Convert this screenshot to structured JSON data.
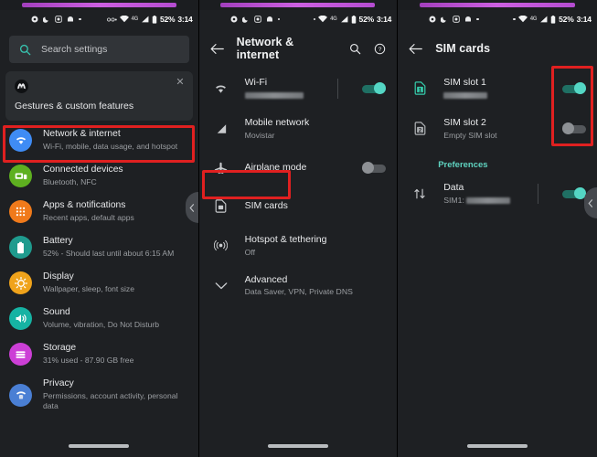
{
  "statusbar": {
    "notif_icons": [
      "record-icon",
      "dnd-moon-icon",
      "screenshot-icon",
      "arch-icon",
      "dot-icon"
    ],
    "vpn_icon": "vpn-key-icon",
    "wifi_icon": "wifi-icon",
    "network_type": "4G",
    "signal_icon": "signal-bars-icon",
    "battery_icon": "battery-icon",
    "battery_percent": "52%",
    "clock": "3:14"
  },
  "panel1": {
    "search": {
      "placeholder": "Search settings",
      "icon": "search-icon"
    },
    "promo": {
      "logo": "motorola-logo-icon",
      "title": "Gestures & custom features",
      "close": "close-icon"
    },
    "items": [
      {
        "title": "Network & internet",
        "sub": "Wi-Fi, mobile, data usage, and hotspot",
        "icon": "wifi-icon",
        "color": "#3f8cf5",
        "highlight": true
      },
      {
        "title": "Connected devices",
        "sub": "Bluetooth, NFC",
        "icon": "devices-icon",
        "color": "#5eb020",
        "highlight": false
      },
      {
        "title": "Apps & notifications",
        "sub": "Recent apps, default apps",
        "icon": "apps-grid-icon",
        "color": "#f07a1b",
        "highlight": false
      },
      {
        "title": "Battery",
        "sub": "52% - Should last until about 6:15 AM",
        "icon": "battery-icon",
        "color": "#1f9b8e",
        "highlight": false
      },
      {
        "title": "Display",
        "sub": "Wallpaper, sleep, font size",
        "icon": "brightness-icon",
        "color": "#f0a31b",
        "highlight": false
      },
      {
        "title": "Sound",
        "sub": "Volume, vibration, Do Not Disturb",
        "icon": "volume-icon",
        "color": "#16b3a3",
        "highlight": false
      },
      {
        "title": "Storage",
        "sub": "31% used - 87.90 GB free",
        "icon": "storage-icon",
        "color": "#cc3fd6",
        "highlight": false
      },
      {
        "title": "Privacy",
        "sub": "Permissions, account activity, personal data",
        "icon": "privacy-icon",
        "color": "#4a7fd4",
        "highlight": false
      }
    ],
    "edge_arrow": "chevron-left-icon"
  },
  "panel2": {
    "appbar": {
      "back": "back-arrow-icon",
      "title": "Network & internet",
      "search": "search-icon",
      "help": "help-icon"
    },
    "items": [
      {
        "title": "Wi-Fi",
        "sub": "",
        "redacted": true,
        "icon": "wifi-icon",
        "toggle": "on",
        "divider": true,
        "highlight": false
      },
      {
        "title": "Mobile network",
        "sub": "Movistar",
        "redacted": false,
        "icon": "signal-bars-icon",
        "toggle": "none",
        "divider": false,
        "highlight": false
      },
      {
        "title": "Airplane mode",
        "sub": "",
        "redacted": false,
        "icon": "airplane-icon",
        "toggle": "off",
        "divider": false,
        "highlight": false
      },
      {
        "title": "SIM cards",
        "sub": "",
        "redacted": false,
        "icon": "sim-card-icon",
        "toggle": "none",
        "divider": false,
        "highlight": true
      },
      {
        "title": "Hotspot & tethering",
        "sub": "Off",
        "redacted": false,
        "icon": "hotspot-icon",
        "toggle": "none",
        "divider": false,
        "highlight": false
      },
      {
        "title": "Advanced",
        "sub": "Data Saver, VPN, Private DNS",
        "redacted": false,
        "icon": "chevron-down-icon",
        "toggle": "none",
        "divider": false,
        "highlight": false
      }
    ]
  },
  "panel3": {
    "appbar": {
      "back": "back-arrow-icon",
      "title": "SIM cards"
    },
    "items": [
      {
        "title": "SIM slot 1",
        "sub": "",
        "redacted": true,
        "icon": "sim-1-icon",
        "toggle": "on"
      },
      {
        "title": "SIM slot 2",
        "sub": "Empty SIM slot",
        "redacted": false,
        "icon": "sim-2-icon",
        "toggle": "off"
      }
    ],
    "section": "Preferences",
    "pref": {
      "title": "Data",
      "sub": "SIM1:",
      "redacted": true,
      "icon": "data-transfer-icon",
      "toggle": "on"
    },
    "edge_arrow": "chevron-left-icon"
  },
  "colors": {
    "highlight": "#e02020",
    "accent_teal": "#5fd3c0",
    "bg": "#1e2023"
  }
}
